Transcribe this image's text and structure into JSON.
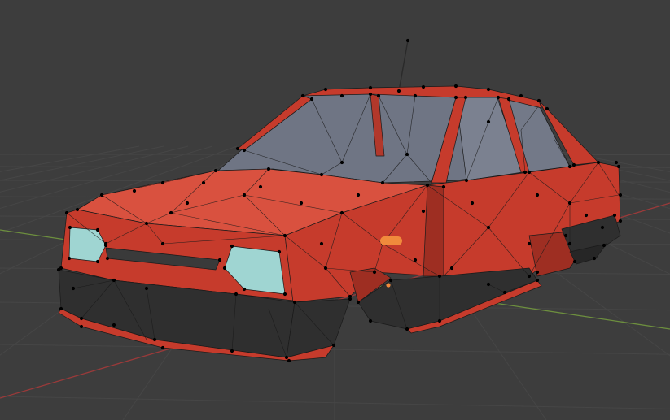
{
  "viewport": {
    "view": "3d-viewport",
    "mode": "edit-mode",
    "object": "car-mesh"
  },
  "colors": {
    "background": "#3d3d3d",
    "grid_line": "#464646",
    "x_axis": "#9a3a3a",
    "y_axis": "#6d8f3e",
    "body_red": "#c63b2c",
    "body_red_light": "#d9513f",
    "body_red_dark": "#9e2e22",
    "glass": "#6f7584",
    "bumper": "#2f2f2f",
    "headlight": "#9fd5d2",
    "indicator": "#f08a3c",
    "wire": "#1a1a1a",
    "vertex": "#000000",
    "antenna": "#2a2a2a",
    "origin": "#f08a3c"
  },
  "icons": [
    "antenna",
    "origin-point"
  ]
}
